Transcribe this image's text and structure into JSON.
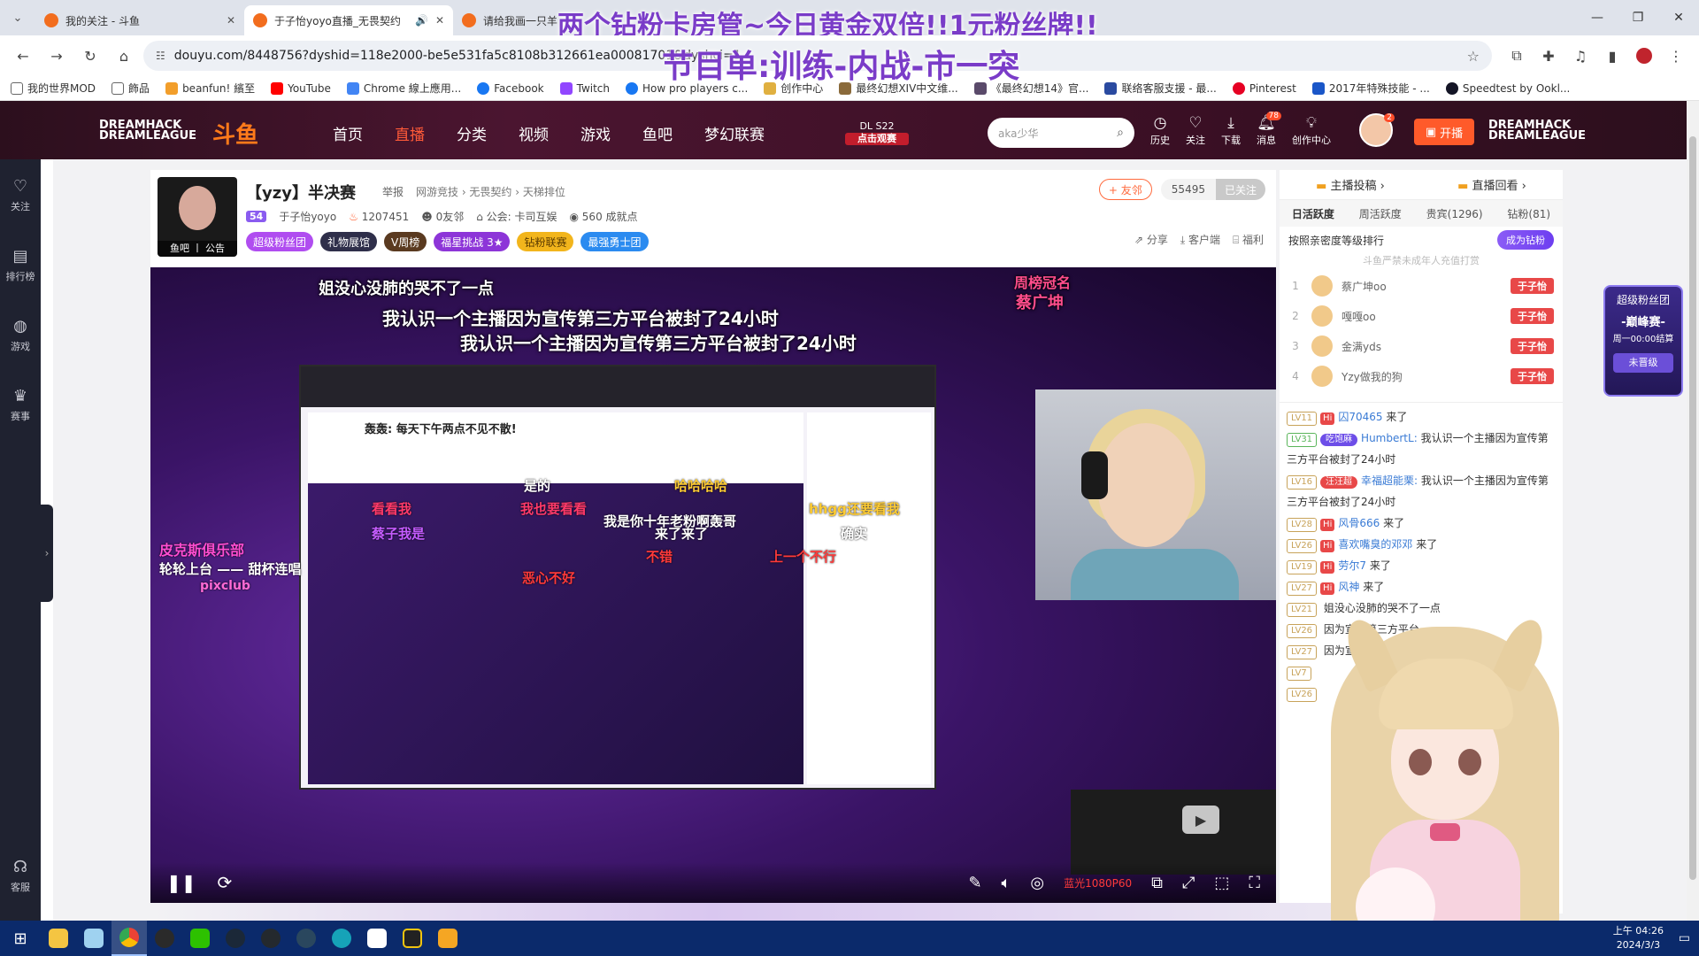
{
  "overlay": {
    "line1": "两个钻粉卡房管~今日黄金双倍!!1元粉丝牌!!",
    "line2": "节目单:训练-内战-市一突"
  },
  "browser": {
    "tabs": [
      {
        "title": "我的关注 - 斗鱼",
        "active": false
      },
      {
        "title": "于子怡yoyo直播_无畏契约",
        "active": true
      },
      {
        "title": "请给我画一只羊",
        "active": false
      }
    ],
    "url": "douyu.com/8448756?dyshid=118e2000-be5e531fa5c8108b312661ea00081701&dyshci=1",
    "bookmarks": [
      "我的世界MOD",
      "飾品",
      "beanfun! 繽至",
      "YouTube",
      "Chrome 線上應用...",
      "Facebook",
      "Twitch",
      "How pro players c...",
      "创作中心",
      "最终幻想XIV中文维...",
      "《最终幻想14》官...",
      "联络客服支援 - 最...",
      "Pinterest",
      "2017年特殊技能 - ...",
      "Speedtest by Ookl..."
    ]
  },
  "nav": {
    "logo_left": "DREAMHACK DREAMLEAGUE",
    "logo_douyu": "斗鱼",
    "links": [
      "首页",
      "直播",
      "分类",
      "视频",
      "游戏",
      "鱼吧",
      "梦幻联赛"
    ],
    "active_index": 1,
    "dl_badge_top": "DL S22",
    "dl_badge_btn": "点击观赛",
    "search_placeholder": "aka少华",
    "icons": [
      {
        "label": "历史",
        "icon": "history-icon"
      },
      {
        "label": "关注",
        "icon": "heart-icon"
      },
      {
        "label": "下载",
        "icon": "download-icon"
      },
      {
        "label": "消息",
        "icon": "bell-icon",
        "badge": "78"
      },
      {
        "label": "创作中心",
        "icon": "bulb-icon"
      }
    ],
    "avatar_badge": "2",
    "kaibo": "开播",
    "logo_right": "DREAMHACK DREAMLEAGUE"
  },
  "sidebar": {
    "items": [
      {
        "label": "关注",
        "icon": "heart-icon"
      },
      {
        "label": "排行榜",
        "icon": "ranking-icon"
      },
      {
        "label": "游戏",
        "icon": "game-icon"
      },
      {
        "label": "赛事",
        "icon": "trophy-icon"
      }
    ],
    "bottom": {
      "label": "客服",
      "icon": "headset-icon"
    }
  },
  "room": {
    "avatar_tag": "鱼吧 丨 公告",
    "title": "【yzy】半决赛",
    "report": "举报",
    "category": "网游竞技 › 无畏契约 › 天梯排位",
    "level": "54",
    "streamer": "于子怡yoyo",
    "heat": "1207451",
    "friends": "0友邻",
    "guild": "公会: 卡司互娱",
    "achievements": "560 成就点",
    "tags": [
      {
        "label": "超级粉丝团",
        "color": "#b04df0"
      },
      {
        "label": "礼物展馆",
        "color": "#2f2f4a"
      },
      {
        "label": "V周榜",
        "color": "#5a3a20"
      },
      {
        "label": "福星挑战 3★",
        "color": "#8d35d8"
      },
      {
        "label": "钻粉联赛",
        "color": "#f2b51c"
      },
      {
        "label": "最强勇士团",
        "color": "#2b8bf0"
      }
    ],
    "btn_friend": "+ 友邻",
    "follow_count": "55495",
    "btn_followed": "已关注",
    "share": "分享",
    "client": "客户端",
    "welfare": "福利"
  },
  "video": {
    "top_caption": "姐没心没肺的哭不了一点",
    "sub1": "我认识一个主播因为宣传第三方平台被封了24小时",
    "sub2": "我认识一个主播因为宣传第三方平台被封了24小时",
    "inner_header": "轰轰: 每天下午两点不见不散!",
    "crown_label": "周榜冠名",
    "crown_name": "蔡广坤",
    "danmu": [
      {
        "text": "我是你十年老粉啊轰哥"
      },
      {
        "text": "是的"
      },
      {
        "text": "看看我"
      },
      {
        "text": "我也要看看"
      },
      {
        "text": "确实"
      },
      {
        "text": "哈哈哈哈"
      },
      {
        "text": "不错"
      },
      {
        "text": "上一个不行"
      },
      {
        "text": "恶心不好"
      },
      {
        "text": "hhgg还要看我"
      },
      {
        "text": "蔡子我是"
      },
      {
        "text": "来了来了"
      }
    ],
    "club_text": "皮克斯俱乐部",
    "club_sub": "轮轮上台 —— 甜杯连唱",
    "club_handle": "pixclub",
    "quality": "蓝光1080P60"
  },
  "right": {
    "top_tabs": [
      "主播投稿",
      "直播回看"
    ],
    "rank_tabs": [
      "日活跃度",
      "周活跃度",
      "贵宾(1296)",
      "钻粉(81)"
    ],
    "rank_tab_active": 0,
    "rank_head": "按照亲密度等级排行",
    "btn_diamond": "成为钻粉",
    "notice": "斗鱼严禁未成年人充值打赏",
    "ranks": [
      {
        "n": "1",
        "name": "蔡广坤oo",
        "badge": "于子怡"
      },
      {
        "n": "2",
        "name": "嘎嘎oo",
        "badge": "于子怡"
      },
      {
        "n": "3",
        "name": "金满yds",
        "badge": "于子怡"
      },
      {
        "n": "4",
        "name": "Yzy做我的狗",
        "badge": "于子怡"
      }
    ],
    "float_card": {
      "t1": "超级粉丝团",
      "t2": "-巅峰赛-",
      "t3": "周一00:00结算",
      "btn": "未晋级"
    },
    "chat": [
      {
        "lv": "LV11",
        "user": "囚70465",
        "text": "来了"
      },
      {
        "lv": "LV31",
        "fan": "吃饱麻",
        "user": "HumbertL:",
        "text": "我认识一个主播因为宣传第三方平台被封了24小时"
      },
      {
        "lv": "LV16",
        "fan": "汪汪超",
        "user": "幸福超能栗:",
        "text": "我认识一个主播因为宣传第三方平台被封了24小时"
      },
      {
        "lv": "LV28",
        "user": "风骨666",
        "text": "来了"
      },
      {
        "lv": "LV26",
        "user": "喜欢嘴臭的邓邓",
        "text": "来了"
      },
      {
        "lv": "LV19",
        "user": "劳尔7",
        "text": "来了"
      },
      {
        "lv": "LV27",
        "user": "风神",
        "text": "来了"
      },
      {
        "lv": "LV21",
        "user": "",
        "text": "姐没心没肺的哭不了一点"
      },
      {
        "lv": "LV26",
        "user": "",
        "text": "因为宣传第三方平台"
      },
      {
        "lv": "LV27",
        "user": "",
        "text": "因为宣传第三方平台24"
      },
      {
        "lv": "LV7",
        "user": "",
        "text": ""
      },
      {
        "lv": "LV26",
        "user": "",
        "text": ""
      }
    ]
  },
  "taskbar": {
    "apps": [
      "file-explorer-icon",
      "notepad-icon",
      "chrome-icon",
      "obs-icon",
      "wechat-icon",
      "steam-icon",
      "github-icon",
      "steam2-icon",
      "browser-icon",
      "bilibili-icon",
      "g-hub-icon",
      "app-icon"
    ],
    "time": "上午 04:26",
    "date": "2024/3/3"
  }
}
